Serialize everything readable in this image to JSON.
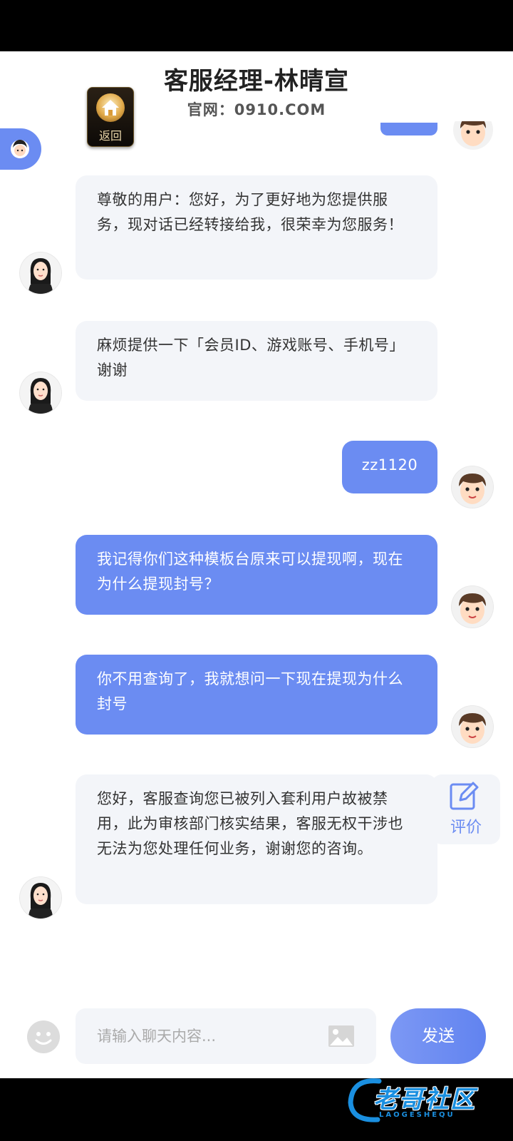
{
  "header": {
    "title": "客服经理-林晴宣",
    "subtitle": "官网：0910.COM"
  },
  "home_button": {
    "label": "返回",
    "icon": "home-icon"
  },
  "left_tab": {
    "icon": "support-avatar-icon"
  },
  "messages": [
    {
      "sender": "agent",
      "text": "尊敬的用户：您好，为了更好地为您提供服务，现对话已经转接给我，很荣幸为您服务！"
    },
    {
      "sender": "agent",
      "text": "麻烦提供一下「会员ID、游戏账号、手机号」谢谢"
    },
    {
      "sender": "user",
      "text": "zz1120"
    },
    {
      "sender": "user",
      "text": "我记得你们这种模板台原来可以提现啊，现在为什么提现封号？"
    },
    {
      "sender": "user",
      "text": "你不用查询了，我就想问一下现在提现为什么封号"
    },
    {
      "sender": "agent",
      "text": "您好，客服查询您已被列入套利用户故被禁用，此为审核部门核实结果，客服无权干涉也无法为您处理任何业务，谢谢您的咨询。"
    }
  ],
  "evaluate_button": {
    "label": "评价",
    "icon": "edit-icon"
  },
  "input": {
    "placeholder": "请输入聊天内容...",
    "value": ""
  },
  "send_button": {
    "label": "发送"
  },
  "icons": {
    "emoji": "emoji-icon",
    "image": "image-icon"
  },
  "watermark": {
    "text": "老哥社区",
    "sub": "LAOGESHEQU"
  },
  "colors": {
    "accent": "#6b8cf2",
    "agent_bubble": "#f3f5f9",
    "user_bubble": "#6b8cf2"
  }
}
